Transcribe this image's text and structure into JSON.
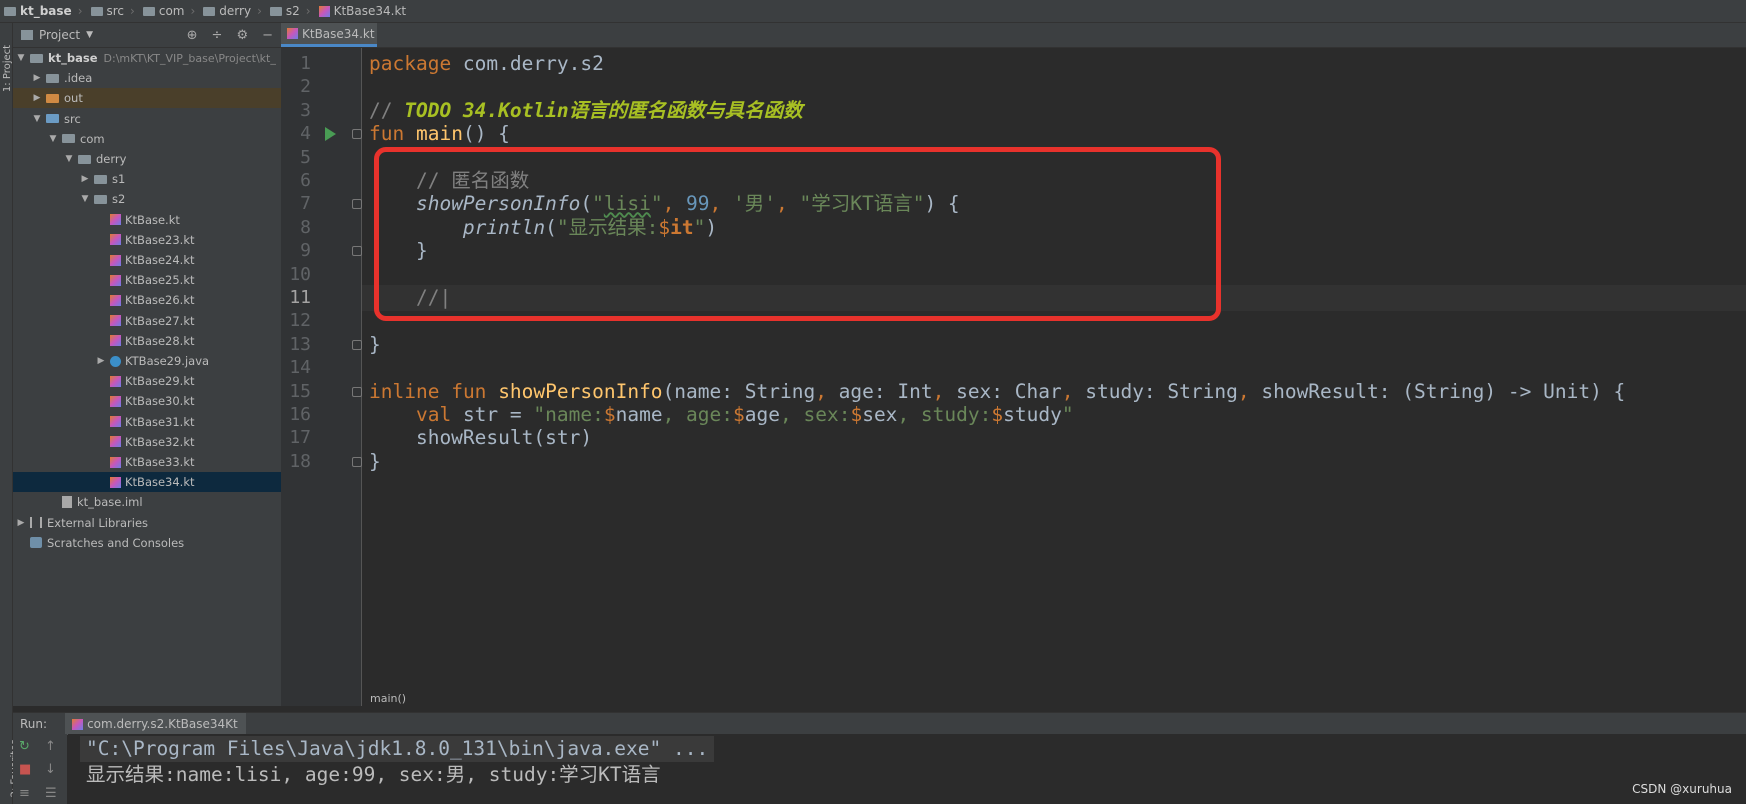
{
  "breadcrumb": [
    "kt_base",
    "src",
    "com",
    "derry",
    "s2",
    "KtBase34.kt"
  ],
  "left_strip": {
    "project_label": "1: Project",
    "favorites_label": "2: Favorites"
  },
  "project_panel": {
    "title": "Project",
    "tree": [
      {
        "label": "kt_base",
        "path": "D:\\mKT\\KT_VIP_base\\Project\\kt_",
        "level": 0,
        "arrow": "▼",
        "icon": "folder",
        "bold": true
      },
      {
        "label": ".idea",
        "level": 1,
        "arrow": "▶",
        "icon": "folder"
      },
      {
        "label": "out",
        "level": 1,
        "arrow": "▶",
        "icon": "folder-orange",
        "highlight": true
      },
      {
        "label": "src",
        "level": 1,
        "arrow": "▼",
        "icon": "folder-blue"
      },
      {
        "label": "com",
        "level": 2,
        "arrow": "▼",
        "icon": "folder"
      },
      {
        "label": "derry",
        "level": 3,
        "arrow": "▼",
        "icon": "folder"
      },
      {
        "label": "s1",
        "level": 4,
        "arrow": "▶",
        "icon": "folder"
      },
      {
        "label": "s2",
        "level": 4,
        "arrow": "▼",
        "icon": "folder"
      },
      {
        "label": "KtBase.kt",
        "level": 5,
        "arrow": "",
        "icon": "kotlin"
      },
      {
        "label": "KtBase23.kt",
        "level": 5,
        "arrow": "",
        "icon": "kotlin"
      },
      {
        "label": "KtBase24.kt",
        "level": 5,
        "arrow": "",
        "icon": "kotlin"
      },
      {
        "label": "KtBase25.kt",
        "level": 5,
        "arrow": "",
        "icon": "kotlin"
      },
      {
        "label": "KtBase26.kt",
        "level": 5,
        "arrow": "",
        "icon": "kotlin"
      },
      {
        "label": "KtBase27.kt",
        "level": 5,
        "arrow": "",
        "icon": "kotlin"
      },
      {
        "label": "KtBase28.kt",
        "level": 5,
        "arrow": "",
        "icon": "kotlin"
      },
      {
        "label": "KTBase29.java",
        "level": 5,
        "arrow": "▶",
        "icon": "java"
      },
      {
        "label": "KtBase29.kt",
        "level": 5,
        "arrow": "",
        "icon": "kotlin"
      },
      {
        "label": "KtBase30.kt",
        "level": 5,
        "arrow": "",
        "icon": "kotlin"
      },
      {
        "label": "KtBase31.kt",
        "level": 5,
        "arrow": "",
        "icon": "kotlin"
      },
      {
        "label": "KtBase32.kt",
        "level": 5,
        "arrow": "",
        "icon": "kotlin"
      },
      {
        "label": "KtBase33.kt",
        "level": 5,
        "arrow": "",
        "icon": "kotlin"
      },
      {
        "label": "KtBase34.kt",
        "level": 5,
        "arrow": "",
        "icon": "kotlin",
        "selected": true
      },
      {
        "label": "kt_base.iml",
        "level": 2,
        "arrow": "",
        "icon": "iml"
      },
      {
        "label": "External Libraries",
        "level": 0,
        "arrow": "▶",
        "icon": "library"
      },
      {
        "label": "Scratches and Consoles",
        "level": 0,
        "arrow": "",
        "icon": "scratch"
      }
    ]
  },
  "editor": {
    "tab": "KtBase34.kt",
    "current_line": 11,
    "footer_breadcrumb": "main()",
    "lines": [
      {
        "n": "1",
        "tokens": [
          {
            "t": "package",
            "c": "kw"
          },
          {
            "t": " com.derry.s2",
            "c": ""
          }
        ]
      },
      {
        "n": "2",
        "tokens": []
      },
      {
        "n": "3",
        "tokens": [
          {
            "t": "// ",
            "c": "cm"
          },
          {
            "t": "TODO 34.Kotlin语言的匿名函数与具名函数",
            "c": "todo"
          }
        ]
      },
      {
        "n": "4",
        "tokens": [
          {
            "t": "fun",
            "c": "kw"
          },
          {
            "t": " ",
            "c": ""
          },
          {
            "t": "main",
            "c": "fn"
          },
          {
            "t": "() {",
            "c": ""
          }
        ]
      },
      {
        "n": "5",
        "tokens": []
      },
      {
        "n": "6",
        "tokens": [
          {
            "t": "    ",
            "c": ""
          },
          {
            "t": "// 匿名函数",
            "c": "cm"
          }
        ]
      },
      {
        "n": "7",
        "tokens": [
          {
            "t": "    ",
            "c": ""
          },
          {
            "t": "showPersonInfo",
            "c": "it"
          },
          {
            "t": "(",
            "c": ""
          },
          {
            "t": "\"",
            "c": "str"
          },
          {
            "t": "lisi",
            "c": "str wavy"
          },
          {
            "t": "\"",
            "c": "str"
          },
          {
            "t": ", ",
            "c": "kw"
          },
          {
            "t": "99",
            "c": "num"
          },
          {
            "t": ", ",
            "c": "kw"
          },
          {
            "t": "'男'",
            "c": "str"
          },
          {
            "t": ", ",
            "c": "kw"
          },
          {
            "t": "\"学习KT语言\"",
            "c": "str"
          },
          {
            "t": ") {",
            "c": ""
          }
        ]
      },
      {
        "n": "8",
        "tokens": [
          {
            "t": "        ",
            "c": ""
          },
          {
            "t": "println",
            "c": "it"
          },
          {
            "t": "(",
            "c": ""
          },
          {
            "t": "\"显示结果:",
            "c": "str"
          },
          {
            "t": "$",
            "c": "interp"
          },
          {
            "t": "it",
            "c": "kw bold"
          },
          {
            "t": "\"",
            "c": "str"
          },
          {
            "t": ")",
            "c": ""
          }
        ]
      },
      {
        "n": "9",
        "tokens": [
          {
            "t": "    }",
            "c": ""
          }
        ]
      },
      {
        "n": "10",
        "tokens": []
      },
      {
        "n": "11",
        "tokens": [
          {
            "t": "    ",
            "c": ""
          },
          {
            "t": "//|",
            "c": "cm"
          }
        ]
      },
      {
        "n": "12",
        "tokens": []
      },
      {
        "n": "13",
        "tokens": [
          {
            "t": "}",
            "c": ""
          }
        ]
      },
      {
        "n": "14",
        "tokens": []
      },
      {
        "n": "15",
        "tokens": [
          {
            "t": "inline",
            "c": "kw"
          },
          {
            "t": " ",
            "c": ""
          },
          {
            "t": "fun",
            "c": "kw"
          },
          {
            "t": " ",
            "c": ""
          },
          {
            "t": "showPersonInfo",
            "c": "fn"
          },
          {
            "t": "(name: String",
            "c": ""
          },
          {
            "t": ", ",
            "c": "kw"
          },
          {
            "t": "age: Int",
            "c": ""
          },
          {
            "t": ", ",
            "c": "kw"
          },
          {
            "t": "sex: Char",
            "c": ""
          },
          {
            "t": ", ",
            "c": "kw"
          },
          {
            "t": "study: String",
            "c": ""
          },
          {
            "t": ", ",
            "c": "kw"
          },
          {
            "t": "showResult: (String) -> Unit) {",
            "c": ""
          }
        ]
      },
      {
        "n": "16",
        "tokens": [
          {
            "t": "    ",
            "c": ""
          },
          {
            "t": "val",
            "c": "kw"
          },
          {
            "t": " str = ",
            "c": ""
          },
          {
            "t": "\"name:",
            "c": "str"
          },
          {
            "t": "$",
            "c": "interp"
          },
          {
            "t": "name",
            "c": ""
          },
          {
            "t": ", age:",
            "c": "str"
          },
          {
            "t": "$",
            "c": "interp"
          },
          {
            "t": "age",
            "c": ""
          },
          {
            "t": ", sex:",
            "c": "str"
          },
          {
            "t": "$",
            "c": "interp"
          },
          {
            "t": "sex",
            "c": ""
          },
          {
            "t": ", study:",
            "c": "str"
          },
          {
            "t": "$",
            "c": "interp"
          },
          {
            "t": "study",
            "c": ""
          },
          {
            "t": "\"",
            "c": "str"
          }
        ]
      },
      {
        "n": "17",
        "tokens": [
          {
            "t": "    showResult(str)",
            "c": ""
          }
        ]
      },
      {
        "n": "18",
        "tokens": [
          {
            "t": "}",
            "c": ""
          }
        ]
      }
    ]
  },
  "run_panel": {
    "label": "Run:",
    "tab": "com.derry.s2.KtBase34Kt",
    "console": [
      "\"C:\\Program Files\\Java\\jdk1.8.0_131\\bin\\java.exe\" ...",
      "显示结果:name:lisi, age:99, sex:男, study:学习KT语言"
    ]
  },
  "watermark": "CSDN @xuruhua",
  "colors": {
    "accent": "#4a88c7",
    "annotation_box": "#e8322c",
    "keyword": "#cc7832",
    "string": "#6a8759"
  }
}
